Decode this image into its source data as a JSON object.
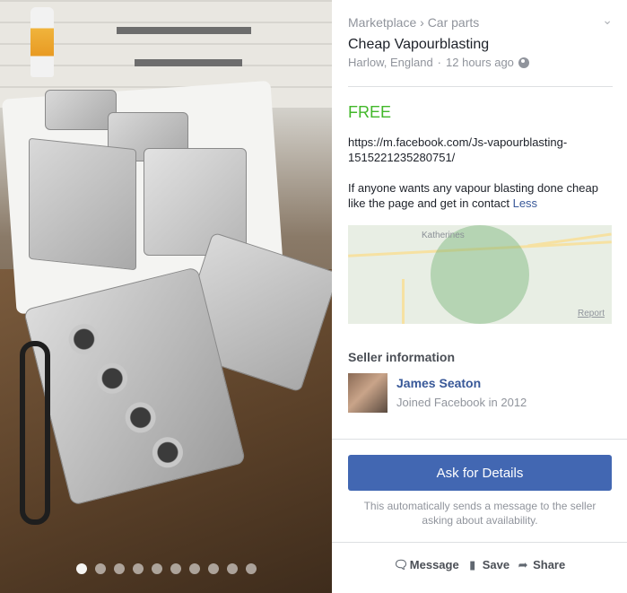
{
  "listing": {
    "breadcrumb": "Marketplace › Car parts",
    "title": "Cheap Vapourblasting",
    "location": "Harlow, England",
    "separator": "·",
    "time": "12 hours ago",
    "price": "FREE",
    "url_line1": "https://m.facebook.com/Js-vapourblasting-",
    "url_line2": "1515221235280751/",
    "description": "If anyone wants any vapour blasting done cheap like the page and get in contact",
    "less_link": "Less"
  },
  "map": {
    "town": "Katherines",
    "report": "Report"
  },
  "seller": {
    "heading": "Seller information",
    "name": "James Seaton",
    "joined": "Joined Facebook in 2012"
  },
  "cta": {
    "ask_label": "Ask for Details",
    "note": "This automatically sends a message to the seller asking about availability."
  },
  "actions": {
    "message": "Message",
    "save": "Save",
    "share": "Share"
  },
  "photo": {
    "dot_count": 10,
    "active_dot": 0
  },
  "colors": {
    "price": "#42b72a",
    "link": "#385898",
    "button": "#4267b2"
  },
  "icons": [
    "chevron-down-icon",
    "globe-icon",
    "messenger-icon",
    "bookmark-icon",
    "share-icon"
  ]
}
